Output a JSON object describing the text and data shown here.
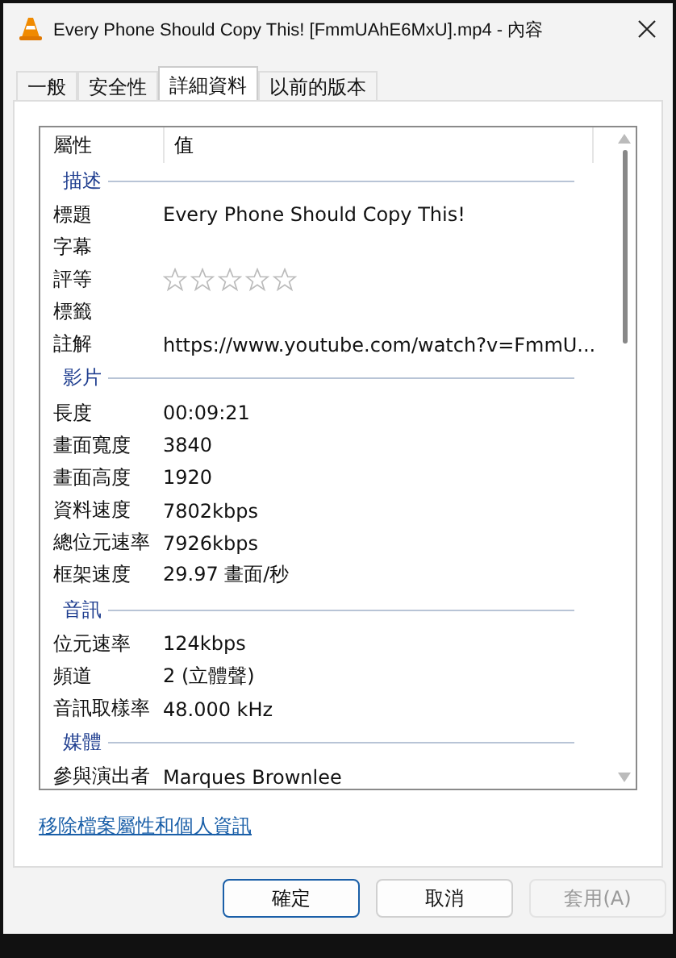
{
  "window": {
    "title": "Every Phone Should Copy This! [FmmUAhE6MxU].mp4 - 內容"
  },
  "tabs": [
    {
      "label": "一般",
      "selected": false
    },
    {
      "label": "安全性",
      "selected": false
    },
    {
      "label": "詳細資料",
      "selected": true
    },
    {
      "label": "以前的版本",
      "selected": false
    }
  ],
  "list": {
    "columns": [
      "屬性",
      "值"
    ],
    "groups": [
      {
        "heading": "描述",
        "rows": [
          {
            "kind": "text",
            "property": "標題",
            "value": "Every Phone Should Copy This!"
          },
          {
            "kind": "text",
            "property": "字幕"
          },
          {
            "kind": "rating",
            "property": "評等",
            "stars": 0
          },
          {
            "kind": "text",
            "property": "標籤"
          },
          {
            "kind": "text",
            "property": "註解",
            "value": "https://www.youtube.com/watch?v=FmmU..."
          }
        ]
      },
      {
        "heading": "影片",
        "rows": [
          {
            "kind": "text",
            "property": "長度",
            "value": "00:09:21"
          },
          {
            "kind": "text",
            "property": "畫面寬度",
            "value": "3840"
          },
          {
            "kind": "text",
            "property": "畫面高度",
            "value": "1920"
          },
          {
            "kind": "text",
            "property": "資料速度",
            "value": "7802kbps"
          },
          {
            "kind": "text",
            "property": "總位元速率",
            "value": "7926kbps"
          },
          {
            "kind": "text",
            "property": "框架速度",
            "value": "29.97 畫面/秒"
          }
        ]
      },
      {
        "heading": "音訊",
        "rows": [
          {
            "kind": "text",
            "property": "位元速率",
            "value": "124kbps"
          },
          {
            "kind": "text",
            "property": "頻道",
            "value": "2 (立體聲)"
          },
          {
            "kind": "text",
            "property": "音訊取樣率",
            "value": "48.000 kHz"
          }
        ]
      },
      {
        "heading": "媒體",
        "rows": [
          {
            "kind": "text",
            "property": "參與演出者",
            "value": "Marques Brownlee"
          }
        ]
      }
    ]
  },
  "link": "移除檔案屬性和個人資訊",
  "buttons": [
    {
      "label": "確定",
      "default": true,
      "disabled": false
    },
    {
      "label": "取消",
      "default": false,
      "disabled": false
    },
    {
      "label": "套用(A)",
      "default": false,
      "disabled": true
    }
  ]
}
